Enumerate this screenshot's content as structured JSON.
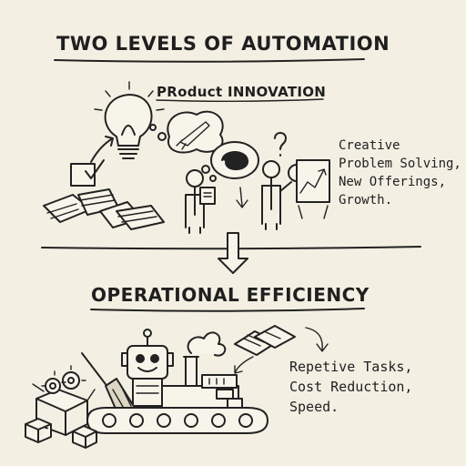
{
  "title": "TWO LEVELS OF AUTOMATION",
  "innovation": {
    "heading": "PRoduct INNOVATION",
    "lines": [
      "Creative",
      "Problem Solving,",
      "New Offerings,",
      "Growth."
    ]
  },
  "efficiency": {
    "heading": "OPERATIONAL EFFICIENCY",
    "lines": [
      "Repetive Tasks,",
      "Cost Reduction,",
      "Speed."
    ]
  }
}
